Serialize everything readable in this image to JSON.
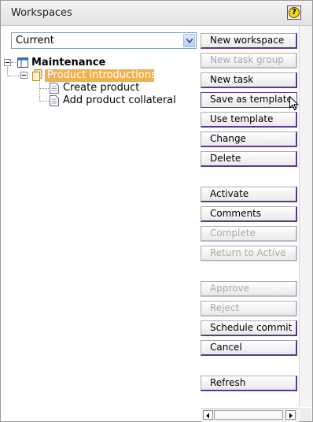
{
  "panel": {
    "title": "Workspaces"
  },
  "filter": {
    "selected": "Current"
  },
  "tree": {
    "root": "Maintenance",
    "group": "Product introductions",
    "tasks": [
      "Create product",
      "Add product collateral"
    ]
  },
  "buttons": [
    {
      "label": "New workspace",
      "enabled": true
    },
    {
      "label": "New task group",
      "enabled": false
    },
    {
      "label": "New task",
      "enabled": true
    },
    {
      "label": "Save as template",
      "enabled": true
    },
    {
      "label": "Use template",
      "enabled": true
    },
    {
      "label": "Change",
      "enabled": true
    },
    {
      "label": "Delete",
      "enabled": true
    },
    {
      "label": "Activate",
      "enabled": true
    },
    {
      "label": "Comments",
      "enabled": true
    },
    {
      "label": "Complete",
      "enabled": false
    },
    {
      "label": "Return to Active",
      "enabled": false
    },
    {
      "label": "Approve",
      "enabled": false
    },
    {
      "label": "Reject",
      "enabled": false
    },
    {
      "label": "Schedule commit",
      "enabled": true
    },
    {
      "label": "Cancel",
      "enabled": true
    },
    {
      "label": "Refresh",
      "enabled": true
    }
  ],
  "colors": {
    "selection": "#f2b04a",
    "button_accent": "#5a3a8a"
  },
  "icons": [
    "help-icon",
    "dropdown-arrow-icon",
    "workspace-icon",
    "task-group-icon",
    "task-document-icon",
    "collapse-icon",
    "scroll-left-icon",
    "scroll-right-icon",
    "mouse-cursor-icon"
  ]
}
